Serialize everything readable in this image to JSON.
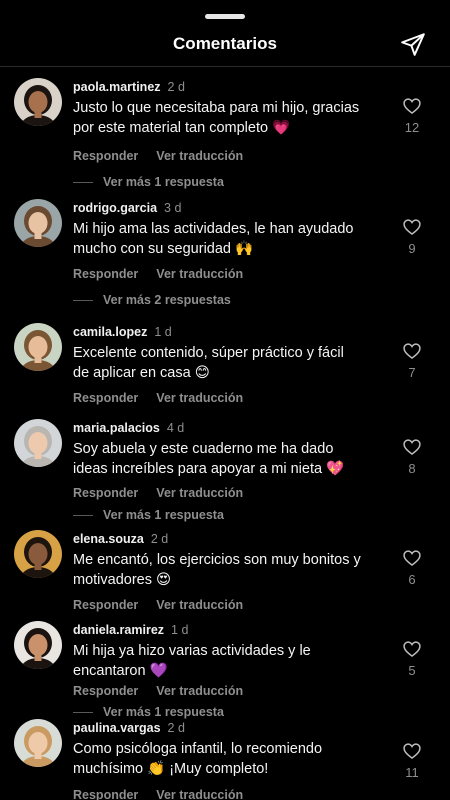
{
  "header": {
    "title": "Comentarios",
    "send_icon": "send-icon"
  },
  "labels": {
    "reply": "Responder",
    "translate": "Ver traducción"
  },
  "comments": [
    {
      "user": "paola.martinez",
      "time": "2 d",
      "text": "Justo lo que necesitaba para mi hijo, gracias por este material tan completo 💗",
      "likes": "12",
      "replies": "Ver más 1 respuesta",
      "avatar_skin": "#a8714e",
      "avatar_hair": "#1c1410",
      "avatar_bg": "#d9d2c9"
    },
    {
      "user": "rodrigo.garcia",
      "time": "3 d",
      "text": "Mi hijo ama las actividades, le han ayudado mucho con su seguridad 🙌",
      "likes": "9",
      "replies": "Ver más 2 respuestas",
      "avatar_skin": "#e8c3a3",
      "avatar_hair": "#6b4a32",
      "avatar_bg": "#9aa5a8"
    },
    {
      "user": "camila.lopez",
      "time": "1 d",
      "text": "Excelente contenido, súper práctico y fácil de aplicar en casa 😊",
      "likes": "7",
      "replies": "",
      "avatar_skin": "#e6bd98",
      "avatar_hair": "#7a5634",
      "avatar_bg": "#c9d4c2"
    },
    {
      "user": "maria.palacios",
      "time": "4 d",
      "text": "Soy abuela y este cuaderno me ha dado ideas increíbles para apoyar a mi nieta 💖",
      "likes": "8",
      "replies": "Ver más 1 respuesta",
      "avatar_skin": "#edc9ad",
      "avatar_hair": "#b9b6b2",
      "avatar_bg": "#d2d6d8"
    },
    {
      "user": "elena.souza",
      "time": "2 d",
      "text": "Me encantó, los ejercicios son muy bonitos y motivadores 😍",
      "likes": "6",
      "replies": "",
      "avatar_skin": "#8a5a3c",
      "avatar_hair": "#1e140e",
      "avatar_bg": "#d7a246"
    },
    {
      "user": "daniela.ramirez",
      "time": "1 d",
      "text": "Mi hija ya hizo varias actividades y le encantaron 💜",
      "likes": "5",
      "replies": "Ver más 1 respuesta",
      "avatar_skin": "#c9926a",
      "avatar_hair": "#1a1310",
      "avatar_bg": "#e9e6e2"
    },
    {
      "user": "paulina.vargas",
      "time": "2 d",
      "text": "Como psicóloga infantil, lo recomiendo muchísimo 👏 ¡Muy completo!",
      "likes": "11",
      "replies": "",
      "avatar_skin": "#efcaa8",
      "avatar_hair": "#c99b62",
      "avatar_bg": "#d8dcd6"
    }
  ]
}
